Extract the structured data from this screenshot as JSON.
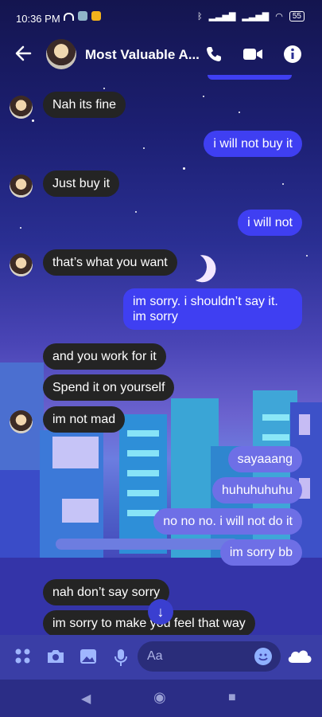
{
  "status_bar": {
    "time": "10:36 PM",
    "battery": "55"
  },
  "header": {
    "title": "Most Valuable A...",
    "icons": [
      "back-arrow-icon",
      "phone-icon",
      "video-icon",
      "info-icon"
    ]
  },
  "messages": [
    {
      "dir": "in",
      "text": "Nah its fine"
    },
    {
      "dir": "out",
      "text": "i will not buy it"
    },
    {
      "dir": "in",
      "text": "Just buy it"
    },
    {
      "dir": "out",
      "text": "i will not"
    },
    {
      "dir": "in",
      "text": "that’s what you want"
    },
    {
      "dir": "out",
      "text": "im sorry. i shouldn’t say it. im sorry"
    },
    {
      "dir": "in",
      "text": "and you work for it"
    },
    {
      "dir": "in",
      "text": "Spend it on yourself"
    },
    {
      "dir": "in",
      "text": "im not mad"
    },
    {
      "dir": "out",
      "text": "sayaaang"
    },
    {
      "dir": "out",
      "text": "huhuhuhuhu"
    },
    {
      "dir": "out",
      "text": "no no no. i will not do it"
    },
    {
      "dir": "out",
      "text": "im sorry bb"
    },
    {
      "dir": "in",
      "text": "nah don’t say sorry"
    },
    {
      "dir": "in",
      "text": "im sorry to make you feel that way"
    }
  ],
  "composer": {
    "placeholder": "Aa",
    "icons": [
      "apps-icon",
      "camera-icon",
      "image-icon",
      "microphone-icon",
      "emoji-icon",
      "cloud-icon"
    ]
  },
  "colors": {
    "incoming_bubble": "#242424",
    "outgoing_bubble": "#3f3ff2",
    "outgoing_bubble_light": "#6e6fe6"
  }
}
